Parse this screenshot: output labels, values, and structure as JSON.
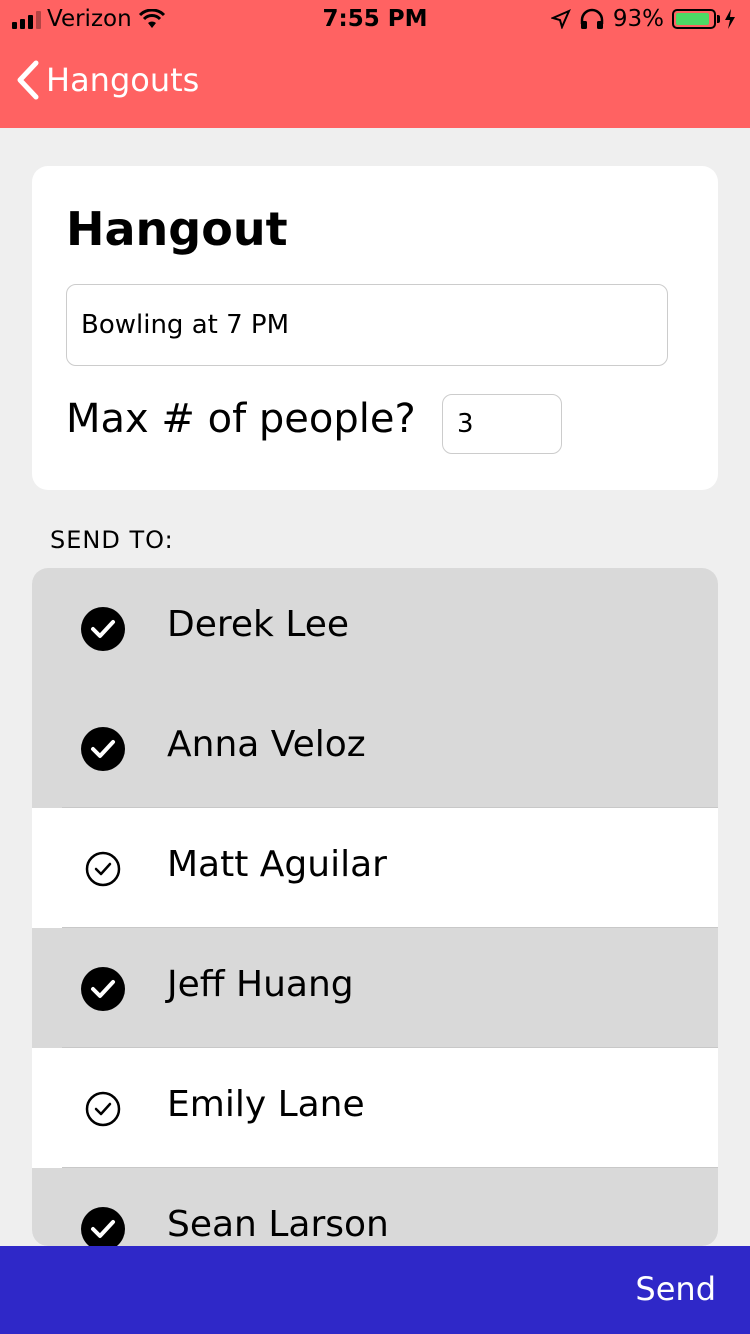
{
  "status_bar": {
    "carrier": "Verizon",
    "time": "7:55 PM",
    "battery": "93%",
    "battery_level": 0.93
  },
  "nav": {
    "back_label": "Hangouts"
  },
  "hangout_card": {
    "title": "Hangout",
    "description_value": "Bowling at 7 PM",
    "max_label": "Max # of people?",
    "max_value": "3"
  },
  "send_to_label": "SEND TO:",
  "contacts": [
    {
      "name": "Derek Lee",
      "selected": true
    },
    {
      "name": "Anna Veloz",
      "selected": true
    },
    {
      "name": "Matt Aguilar",
      "selected": false
    },
    {
      "name": "Jeff Huang",
      "selected": true
    },
    {
      "name": "Emily Lane",
      "selected": false
    },
    {
      "name": "Sean Larson",
      "selected": true
    }
  ],
  "bottom_bar": {
    "send_label": "Send"
  },
  "colors": {
    "header": "#ff6262",
    "bottom_bar": "#2f28c8",
    "selected_row": "#d9d9d9",
    "battery_fill": "#4cd964"
  }
}
